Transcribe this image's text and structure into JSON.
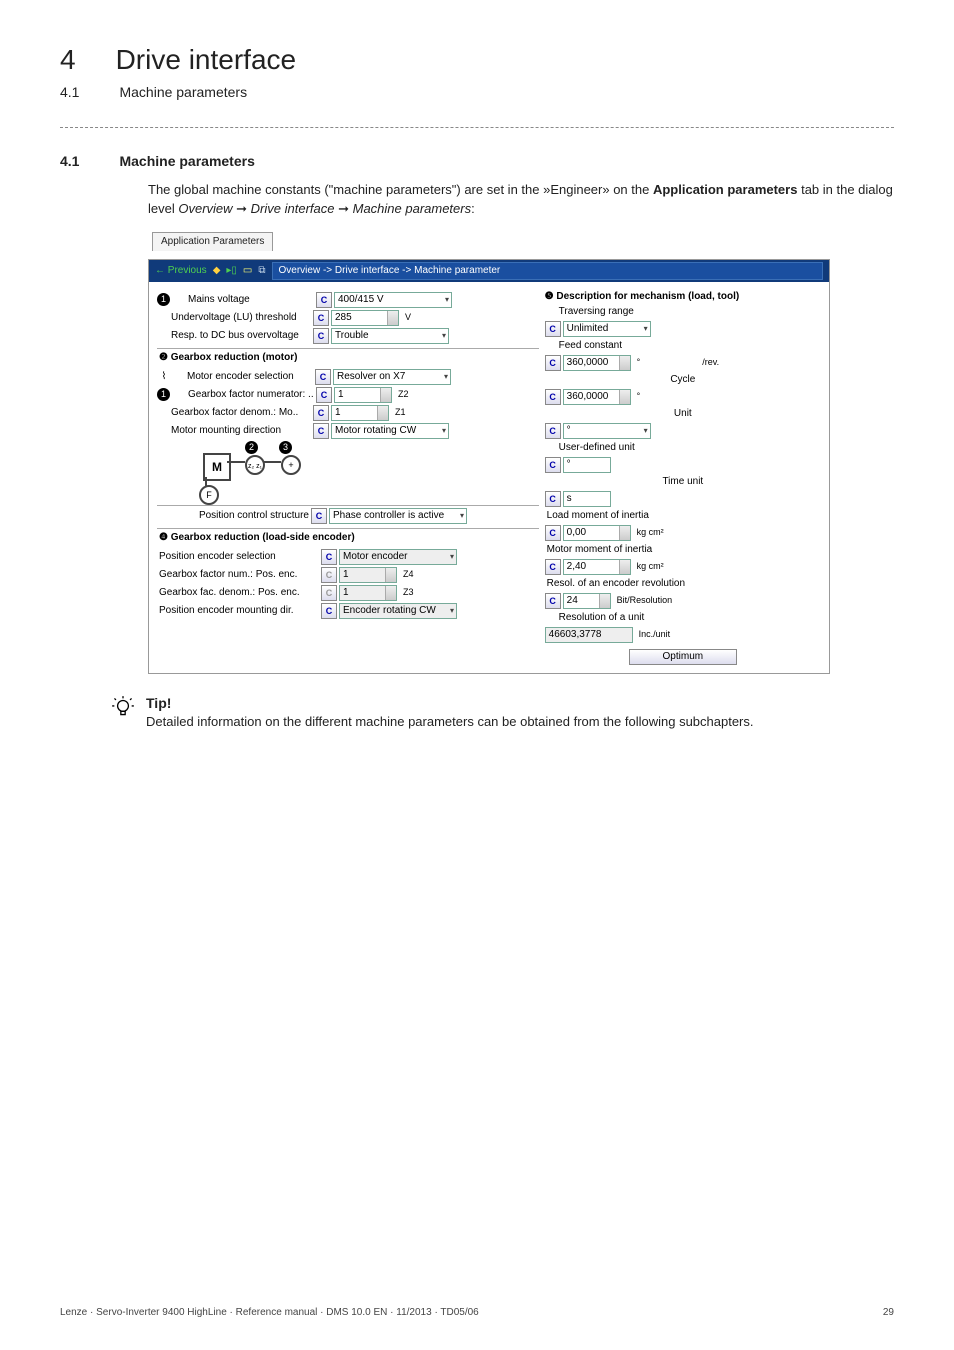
{
  "header": {
    "chapter_num": "4",
    "chapter_title": "Drive interface",
    "sub_num": "4.1",
    "sub_title": "Machine parameters"
  },
  "section": {
    "num": "4.1",
    "title": "Machine parameters",
    "para_before": "The global machine constants (\"machine parameters\") are set in the »Engineer» on the ",
    "para_bold1": "Application parameters",
    "para_mid": " tab in the dialog level ",
    "para_it1": "Overview",
    "arrow1": " ➞ ",
    "para_it2": "Drive interface",
    "arrow2": " ➞ ",
    "para_it3": "Machine parameters",
    "para_end": ":"
  },
  "screenshot": {
    "tab": "Application Parameters",
    "nav_prev": "← Previous",
    "breadcrumb": "Overview -> Drive interface -> Machine parameter",
    "left": {
      "b1": "❶",
      "mains_lbl": "Mains voltage",
      "mains_val": "400/415 V",
      "uv_lbl": "Undervoltage (LU) threshold",
      "uv_val": "285",
      "uv_unit": "V",
      "resp_lbl": "Resp. to DC bus overvoltage",
      "resp_val": "Trouble",
      "sec2_hdr": "❷ Gearbox reduction (motor)",
      "menc_lbl": "Motor encoder selection",
      "menc_val": "Resolver on X7",
      "gnum_lbl": "Gearbox factor numerator: ..",
      "gnum_val": "1",
      "gnum_unit": "Z2",
      "gden_lbl": "Gearbox factor denom.: Mo..",
      "gden_val": "1",
      "gden_unit": "Z1",
      "mmd_lbl": "Motor mounting direction",
      "mmd_val": "Motor rotating CW",
      "b2": "❷",
      "b3": "❸",
      "diag_M": "M",
      "diag_z": "z₂ z₁",
      "diag_plus": "+",
      "diag_F": "F",
      "pcs_lbl": "Position control structure",
      "pcs_val": "Phase controller is active",
      "sec4_hdr": "❹ Gearbox reduction (load-side encoder)",
      "pes_lbl": "Position encoder selection",
      "pes_val": "Motor encoder",
      "gfn_lbl": "Gearbox factor num.: Pos. enc.",
      "gfn_val": "1",
      "gfn_unit": "Z4",
      "gfd_lbl": "Gearbox fac. denom.: Pos. enc.",
      "gfd_val": "1",
      "gfd_unit": "Z3",
      "pemd_lbl": "Position encoder mounting dir.",
      "pemd_val": "Encoder rotating CW"
    },
    "right": {
      "hdr": "❺ Description for mechanism (load, tool)",
      "trav_lbl": "Traversing range",
      "trav_val": "Unlimited",
      "feed_lbl": "Feed constant",
      "feed_val": "360,0000",
      "feed_unit": "°",
      "feed_after": "/rev.",
      "cycle_lbl": "Cycle",
      "cycle_val": "360,0000",
      "cycle_unit": "°",
      "unit_lbl": "Unit",
      "unit_val": "°",
      "udu_lbl": "User-defined unit",
      "udu_val": "°",
      "tu_lbl": "Time unit",
      "tu_val": "s",
      "lmi_lbl": "Load moment of inertia",
      "lmi_val": "0,00",
      "lmi_unit": "kg cm²",
      "mmi_lbl": "Motor moment of inertia",
      "mmi_val": "2,40",
      "mmi_unit": "kg cm²",
      "rer_lbl": "Resol. of an encoder revolution",
      "rer_val": "24",
      "rer_unit": "Bit/Resolution",
      "rou_lbl": "Resolution of a unit",
      "rou_val": "46603,3778",
      "rou_unit": "Inc./unit",
      "opt_btn": "Optimum"
    }
  },
  "tip": {
    "heading": "Tip!",
    "body": "Detailed information on the different machine parameters can be obtained from the following subchapters."
  },
  "footer": {
    "left": "Lenze · Servo-Inverter 9400 HighLine · Reference manual · DMS 10.0 EN · 11/2013 · TD05/06",
    "right": "29"
  }
}
